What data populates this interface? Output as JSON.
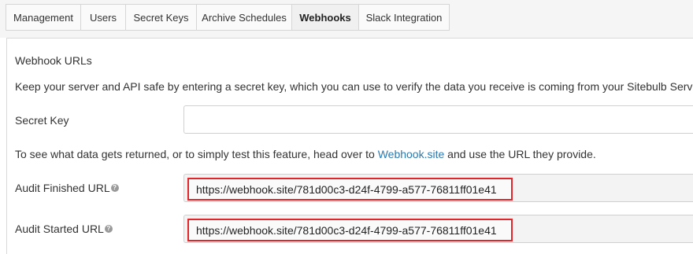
{
  "tabs": [
    {
      "label": "Management"
    },
    {
      "label": "Users"
    },
    {
      "label": "Secret Keys"
    },
    {
      "label": "Archive Schedules"
    },
    {
      "label": "Webhooks",
      "active": true
    },
    {
      "label": "Slack Integration"
    }
  ],
  "section": {
    "title": "Webhook URLs",
    "description": "Keep your server and API safe by entering a secret key, which you can use to verify the data you receive is coming from your Sitebulb Server."
  },
  "secret_key": {
    "label": "Secret Key",
    "value": ""
  },
  "help": {
    "prefix": "To see what data gets returned, or to simply test this feature, head over to ",
    "link_text": "Webhook.site",
    "suffix": " and use the URL they provide."
  },
  "audit_finished": {
    "label": "Audit Finished URL",
    "value": "https://webhook.site/781d00c3-d24f-4799-a577-76811ff01e41"
  },
  "audit_started": {
    "label": "Audit Started URL",
    "value": "https://webhook.site/781d00c3-d24f-4799-a577-76811ff01e41"
  },
  "colors": {
    "highlight": "#e0262a",
    "link": "#2a7ab0"
  },
  "icons": {
    "info": "question-circle-icon"
  }
}
